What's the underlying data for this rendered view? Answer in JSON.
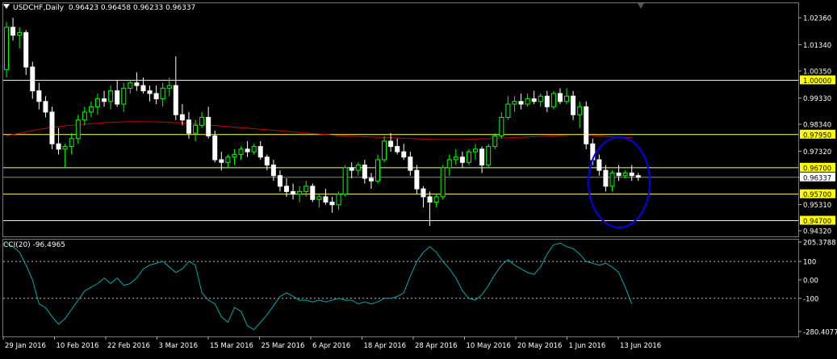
{
  "header": {
    "symbol": "USDCHF,Daily",
    "ohlc": "0.96423 0.96458 0.96233 0.96337"
  },
  "indicator": {
    "title": "CCI(20) -96.4965"
  },
  "colors": {
    "bull_candle": "#00ff00",
    "bear_candle": "#ffffff",
    "level_line": "#ffff66",
    "ma_line": "#cc0000",
    "cci_line": "#00aaaa",
    "highlight_ellipse": "#0000ff",
    "level_label_bg": "#ffff00"
  },
  "chart_data": [
    {
      "type": "candlestick",
      "symbol": "USDCHF",
      "timeframe": "Daily",
      "ylim": [
        0.9432,
        1.0236
      ],
      "y_ticks": [
        "1.02360",
        "1.01340",
        "1.00350",
        "0.99330",
        "0.98340",
        "0.97320",
        "0.96337",
        "0.95310",
        "0.94320"
      ],
      "current_price": "0.96337",
      "x_ticks": [
        "29 Jan 2016",
        "10 Feb 2016",
        "22 Feb 2016",
        "3 Mar 2016",
        "15 Mar 2016",
        "25 Mar 2016",
        "6 Apr 2016",
        "18 Apr 2016",
        "28 Apr 2016",
        "10 May 2016",
        "20 May 2016",
        "1 Jun 2016",
        "13 Jun 2016"
      ],
      "levels": [
        {
          "value": 1.0,
          "label": "1.00000"
        },
        {
          "value": 0.9795,
          "label": "0.97950"
        },
        {
          "value": 0.967,
          "label": "0.96700"
        },
        {
          "value": 0.957,
          "label": "0.95700"
        },
        {
          "value": 0.947,
          "label": "0.94700"
        }
      ],
      "ohlc": [
        [
          1.004,
          1.022,
          1.001,
          1.02
        ],
        [
          1.02,
          1.0236,
          1.015,
          1.017
        ],
        [
          1.017,
          1.02,
          1.012,
          1.018
        ],
        [
          1.018,
          1.019,
          1.002,
          1.005
        ],
        [
          1.005,
          1.007,
          0.993,
          0.996
        ],
        [
          0.996,
          0.999,
          0.989,
          0.992
        ],
        [
          0.992,
          0.994,
          0.986,
          0.988
        ],
        [
          0.988,
          0.99,
          0.974,
          0.976
        ],
        [
          0.976,
          0.982,
          0.972,
          0.974
        ],
        [
          0.974,
          0.976,
          0.967,
          0.975
        ],
        [
          0.975,
          0.98,
          0.972,
          0.978
        ],
        [
          0.978,
          0.987,
          0.976,
          0.985
        ],
        [
          0.985,
          0.99,
          0.983,
          0.988
        ],
        [
          0.988,
          0.992,
          0.986,
          0.99
        ],
        [
          0.99,
          0.995,
          0.987,
          0.993
        ],
        [
          0.993,
          0.996,
          0.99,
          0.992
        ],
        [
          0.992,
          0.998,
          0.989,
          0.996
        ],
        [
          0.996,
          1.0,
          0.99,
          0.991
        ],
        [
          0.991,
          0.999,
          0.988,
          0.997
        ],
        [
          0.997,
          1.0,
          0.995,
          0.999
        ],
        [
          0.999,
          1.003,
          0.996,
          0.998
        ],
        [
          0.998,
          1.001,
          0.995,
          0.996
        ],
        [
          0.996,
          0.998,
          0.992,
          0.995
        ],
        [
          0.995,
          0.998,
          0.991,
          0.993
        ],
        [
          0.993,
          0.999,
          0.99,
          0.997
        ],
        [
          0.997,
          1.001,
          0.994,
          0.998
        ],
        [
          0.998,
          1.009,
          0.985,
          0.987
        ],
        [
          0.987,
          0.991,
          0.983,
          0.985
        ],
        [
          0.985,
          0.988,
          0.978,
          0.98
        ],
        [
          0.98,
          0.985,
          0.977,
          0.983
        ],
        [
          0.983,
          0.988,
          0.982,
          0.986
        ],
        [
          0.986,
          0.99,
          0.978,
          0.979
        ],
        [
          0.979,
          0.981,
          0.969,
          0.97
        ],
        [
          0.97,
          0.973,
          0.966,
          0.969
        ],
        [
          0.969,
          0.972,
          0.967,
          0.971
        ],
        [
          0.971,
          0.974,
          0.968,
          0.972
        ],
        [
          0.972,
          0.975,
          0.97,
          0.974
        ],
        [
          0.974,
          0.977,
          0.971,
          0.973
        ],
        [
          0.973,
          0.976,
          0.972,
          0.975
        ],
        [
          0.975,
          0.977,
          0.97,
          0.971
        ],
        [
          0.971,
          0.972,
          0.966,
          0.968
        ],
        [
          0.968,
          0.97,
          0.962,
          0.964
        ],
        [
          0.964,
          0.966,
          0.958,
          0.96
        ],
        [
          0.96,
          0.963,
          0.956,
          0.958
        ],
        [
          0.958,
          0.961,
          0.955,
          0.957
        ],
        [
          0.957,
          0.96,
          0.954,
          0.958
        ],
        [
          0.958,
          0.962,
          0.956,
          0.96
        ],
        [
          0.96,
          0.961,
          0.954,
          0.955
        ],
        [
          0.955,
          0.957,
          0.952,
          0.956
        ],
        [
          0.956,
          0.959,
          0.953,
          0.954
        ],
        [
          0.954,
          0.956,
          0.95,
          0.953
        ],
        [
          0.953,
          0.958,
          0.951,
          0.957
        ],
        [
          0.957,
          0.968,
          0.956,
          0.967
        ],
        [
          0.967,
          0.969,
          0.963,
          0.966
        ],
        [
          0.966,
          0.969,
          0.964,
          0.968
        ],
        [
          0.968,
          0.97,
          0.961,
          0.963
        ],
        [
          0.963,
          0.965,
          0.959,
          0.962
        ],
        [
          0.962,
          0.972,
          0.961,
          0.97
        ],
        [
          0.97,
          0.979,
          0.969,
          0.977
        ],
        [
          0.977,
          0.98,
          0.973,
          0.975
        ],
        [
          0.975,
          0.978,
          0.972,
          0.973
        ],
        [
          0.973,
          0.976,
          0.97,
          0.971
        ],
        [
          0.971,
          0.973,
          0.964,
          0.966
        ],
        [
          0.966,
          0.968,
          0.957,
          0.959
        ],
        [
          0.959,
          0.96,
          0.952,
          0.956
        ],
        [
          0.956,
          0.958,
          0.945,
          0.954
        ],
        [
          0.954,
          0.957,
          0.952,
          0.956
        ],
        [
          0.956,
          0.968,
          0.955,
          0.967
        ],
        [
          0.967,
          0.972,
          0.964,
          0.97
        ],
        [
          0.97,
          0.974,
          0.968,
          0.971
        ],
        [
          0.971,
          0.973,
          0.967,
          0.969
        ],
        [
          0.969,
          0.974,
          0.968,
          0.973
        ],
        [
          0.973,
          0.976,
          0.97,
          0.974
        ],
        [
          0.974,
          0.975,
          0.965,
          0.968
        ],
        [
          0.968,
          0.976,
          0.967,
          0.975
        ],
        [
          0.975,
          0.98,
          0.974,
          0.979
        ],
        [
          0.979,
          0.988,
          0.978,
          0.986
        ],
        [
          0.986,
          0.994,
          0.985,
          0.991
        ],
        [
          0.991,
          0.994,
          0.988,
          0.992
        ],
        [
          0.992,
          0.995,
          0.989,
          0.991
        ],
        [
          0.991,
          0.995,
          0.99,
          0.993
        ],
        [
          0.993,
          0.996,
          0.991,
          0.992
        ],
        [
          0.992,
          0.995,
          0.99,
          0.994
        ],
        [
          0.994,
          0.996,
          0.988,
          0.99
        ],
        [
          0.99,
          0.996,
          0.989,
          0.995
        ],
        [
          0.995,
          0.997,
          0.991,
          0.992
        ],
        [
          0.992,
          0.997,
          0.991,
          0.994
        ],
        [
          0.994,
          0.996,
          0.985,
          0.987
        ],
        [
          0.987,
          0.992,
          0.982,
          0.99
        ],
        [
          0.99,
          0.992,
          0.974,
          0.976
        ],
        [
          0.976,
          0.978,
          0.968,
          0.97
        ],
        [
          0.97,
          0.972,
          0.964,
          0.966
        ],
        [
          0.966,
          0.968,
          0.958,
          0.96
        ],
        [
          0.96,
          0.966,
          0.958,
          0.965
        ],
        [
          0.965,
          0.968,
          0.962,
          0.964
        ],
        [
          0.964,
          0.966,
          0.963,
          0.965
        ],
        [
          0.965,
          0.968,
          0.962,
          0.964
        ],
        [
          0.964,
          0.965,
          0.962,
          0.9634
        ]
      ],
      "ma": [
        0.979,
        0.9795,
        0.98,
        0.9805,
        0.981,
        0.9815,
        0.9818,
        0.9822,
        0.9825,
        0.9828,
        0.983,
        0.9832,
        0.9834,
        0.9836,
        0.9838,
        0.984,
        0.9841,
        0.9842,
        0.9843,
        0.9844,
        0.9844,
        0.9844,
        0.9843,
        0.9843,
        0.9842,
        0.9841,
        0.984,
        0.9839,
        0.9837,
        0.9835,
        0.9833,
        0.9831,
        0.9829,
        0.9827,
        0.9825,
        0.9823,
        0.9821,
        0.9819,
        0.9817,
        0.9815,
        0.9813,
        0.9811,
        0.9809,
        0.9807,
        0.9805,
        0.9803,
        0.9801,
        0.9799,
        0.9797,
        0.9795,
        0.9793,
        0.9791,
        0.979,
        0.9789,
        0.9788,
        0.9787,
        0.9786,
        0.9785,
        0.9784,
        0.9783,
        0.9782,
        0.9781,
        0.978,
        0.9779,
        0.9778,
        0.9777,
        0.9776,
        0.9776,
        0.9776,
        0.9776,
        0.9776,
        0.9777,
        0.9778,
        0.9779,
        0.978,
        0.9781,
        0.9782,
        0.9783,
        0.9784,
        0.9785,
        0.9786,
        0.9787,
        0.9788,
        0.9789,
        0.979,
        0.9791,
        0.9792,
        0.9793,
        0.9793,
        0.9792,
        0.9791,
        0.979,
        0.9788,
        0.9786,
        0.9785,
        0.9784,
        0.9783
      ]
    },
    {
      "type": "line",
      "name": "CCI(20)",
      "current_value": "-96.4965",
      "ylim": [
        -280.4077,
        205.3788
      ],
      "y_ticks": [
        "205.3788",
        "100",
        "0.00",
        "-100",
        "-280.4077"
      ],
      "reference_lines": [
        100,
        -100
      ],
      "values": [
        200,
        180,
        150,
        80,
        0,
        -130,
        -150,
        -200,
        -240,
        -210,
        -160,
        -110,
        -60,
        -40,
        -20,
        10,
        -20,
        10,
        -30,
        -20,
        10,
        60,
        80,
        90,
        100,
        70,
        40,
        60,
        100,
        80,
        -70,
        -110,
        -130,
        -200,
        -230,
        -150,
        -170,
        -250,
        -270,
        -230,
        -190,
        -140,
        -90,
        -70,
        -90,
        -110,
        -110,
        -120,
        -110,
        -120,
        -110,
        -100,
        -110,
        -110,
        -130,
        -120,
        -130,
        -120,
        -100,
        -100,
        -90,
        -70,
        20,
        100,
        150,
        180,
        150,
        100,
        60,
        10,
        -60,
        -100,
        -110,
        -80,
        -30,
        30,
        80,
        110,
        80,
        60,
        40,
        30,
        70,
        140,
        190,
        200,
        180,
        170,
        140,
        100,
        90,
        80,
        90,
        70,
        40,
        -40,
        -130
      ]
    }
  ]
}
